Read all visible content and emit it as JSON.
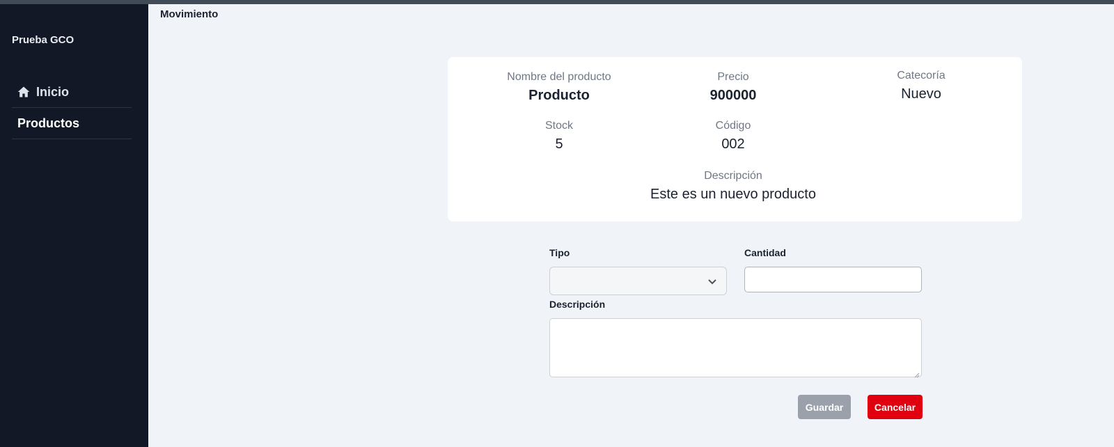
{
  "app": {
    "brand": "Prueba GCO",
    "page_title": "Movimiento"
  },
  "sidebar": {
    "items": [
      {
        "label": "Inicio",
        "icon": "home-icon"
      },
      {
        "label": "Productos"
      }
    ]
  },
  "product": {
    "name_label": "Nombre del producto",
    "name": "Producto",
    "price_label": "Precio",
    "price": "900000",
    "category_label": "Catecoría",
    "category": "Nuevo",
    "stock_label": "Stock",
    "stock": "5",
    "code_label": "Código",
    "code": "002",
    "description_label": "Descripción",
    "description": "Este es un nuevo producto"
  },
  "form": {
    "type_label": "Tipo",
    "type_value": "",
    "quantity_label": "Cantidad",
    "quantity_value": "",
    "description_label": "Descripción",
    "description_value": "",
    "save_label": "Guardar",
    "cancel_label": "Cancelar"
  },
  "colors": {
    "sidebar": "#121826",
    "background": "#f0f3f7",
    "save_button": "#9aa1ab",
    "cancel_button": "#e0000f"
  }
}
